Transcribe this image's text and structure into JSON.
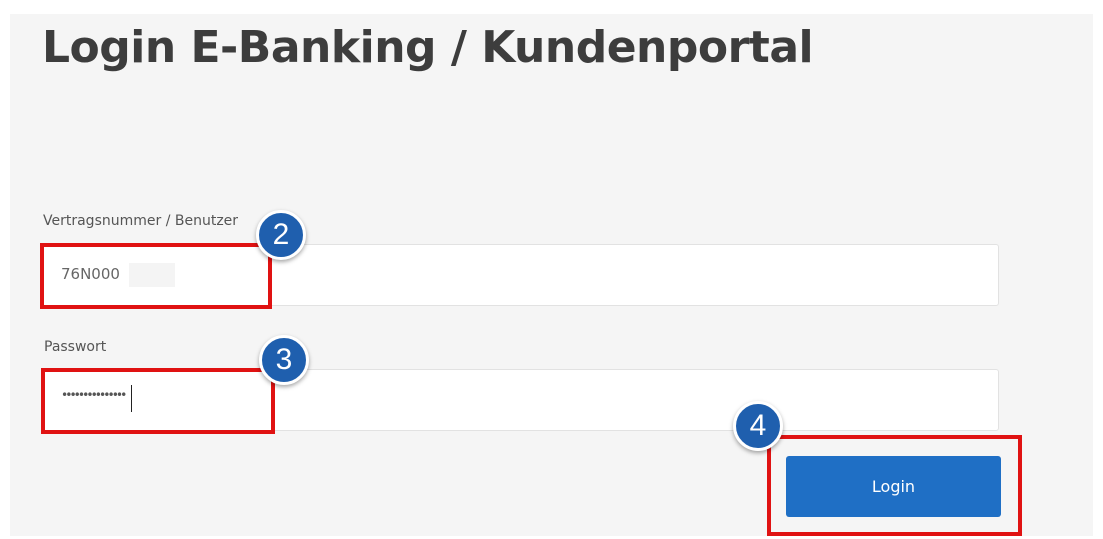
{
  "page": {
    "title": "Login E-Banking / Kundenportal"
  },
  "form": {
    "username_label": "Vertragsnummer / Benutzer",
    "username_value": "76N000",
    "password_label": "Passwort",
    "password_value": "•••••••••••••••",
    "login_label": "Login"
  },
  "annotations": {
    "step_username": "2",
    "step_password": "3",
    "step_login": "4"
  },
  "colors": {
    "background_panel": "#f5f5f5",
    "title_text": "#3d3d3d",
    "button_primary": "#1f6fc5",
    "highlight_red": "#e01212",
    "badge_blue": "#1f5fae"
  }
}
